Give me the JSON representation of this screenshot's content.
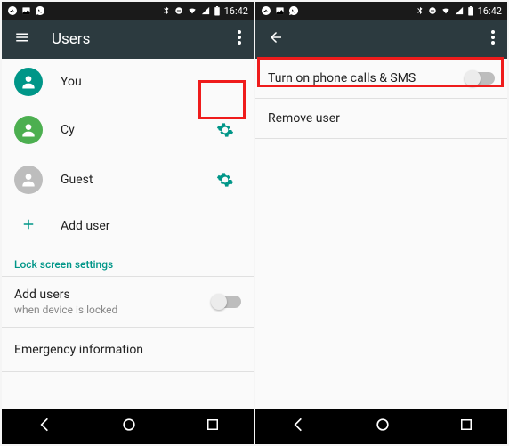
{
  "status": {
    "time": "16:42"
  },
  "left_screen": {
    "title": "Users",
    "users": [
      {
        "label": "You"
      },
      {
        "label": "Cy"
      },
      {
        "label": "Guest"
      }
    ],
    "add_user": "Add user",
    "section_header": "Lock screen settings",
    "add_users_title": "Add users",
    "add_users_sub": "when device is locked",
    "emergency_info": "Emergency information"
  },
  "right_screen": {
    "toggle_label": "Turn on phone calls & SMS",
    "remove_user": "Remove user"
  }
}
